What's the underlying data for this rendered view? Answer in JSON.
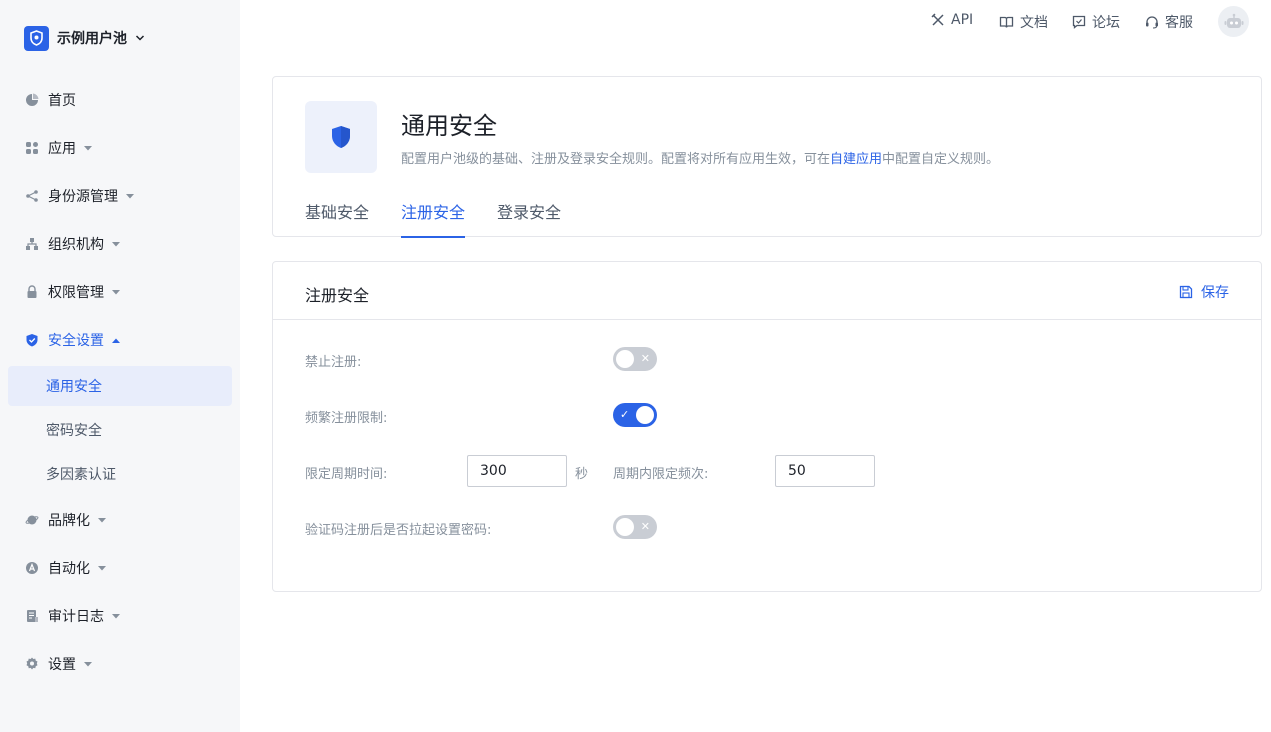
{
  "sidebar": {
    "pool_name": "示例用户池",
    "items": [
      {
        "label": "首页",
        "icon": "pie-chart-icon"
      },
      {
        "label": "应用",
        "icon": "apps-icon"
      },
      {
        "label": "身份源管理",
        "icon": "share-icon"
      },
      {
        "label": "组织机构",
        "icon": "org-icon"
      },
      {
        "label": "权限管理",
        "icon": "lock-icon"
      },
      {
        "label": "安全设置",
        "icon": "shield-icon"
      },
      {
        "label": "品牌化",
        "icon": "planet-icon"
      },
      {
        "label": "自动化",
        "icon": "automation-icon"
      },
      {
        "label": "审计日志",
        "icon": "log-icon"
      },
      {
        "label": "设置",
        "icon": "gear-icon"
      }
    ],
    "security_sub": [
      "通用安全",
      "密码安全",
      "多因素认证"
    ]
  },
  "topbar": {
    "api": "API",
    "docs": "文档",
    "forum": "论坛",
    "support": "客服"
  },
  "header": {
    "title": "通用安全",
    "desc_prefix": "配置用户池级的基础、注册及登录安全规则。配置将对所有应用生效，可在",
    "desc_link": "自建应用",
    "desc_suffix": "中配置自定义规则。",
    "tabs": [
      "基础安全",
      "注册安全",
      "登录安全"
    ],
    "active_tab": "注册安全"
  },
  "form": {
    "title": "注册安全",
    "save": "保存",
    "disable_register": {
      "label": "禁止注册:",
      "enabled": false
    },
    "rate_limit": {
      "label": "频繁注册限制:",
      "enabled": true
    },
    "period": {
      "label": "限定周期时间:",
      "value": "300",
      "unit": "秒"
    },
    "frequency": {
      "label": "周期内限定频次:",
      "value": "50"
    },
    "set_password": {
      "label": "验证码注册后是否拉起设置密码:",
      "enabled": false
    }
  },
  "colors": {
    "primary": "#2b63e6",
    "sidebar_bg": "#f6f7f9",
    "active_bg": "#e8edfb",
    "switch_off": "#c9cdd4"
  }
}
